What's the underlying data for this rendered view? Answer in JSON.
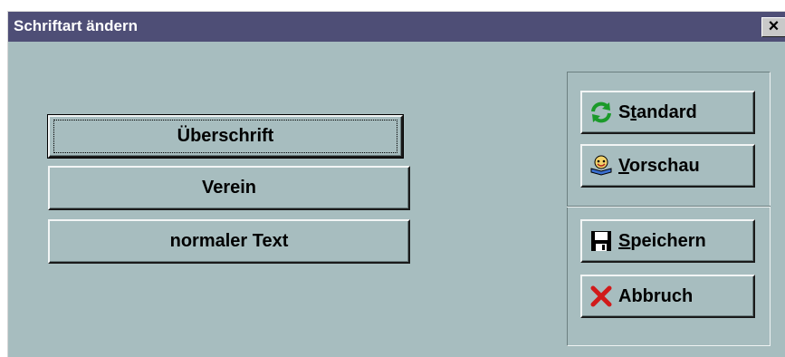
{
  "window": {
    "title": "Schriftart ändern",
    "close_label": "×"
  },
  "font_buttons": [
    {
      "label": "Überschrift",
      "focused": true
    },
    {
      "label": "Verein",
      "focused": false
    },
    {
      "label": "normaler Text",
      "focused": false
    }
  ],
  "side_buttons": {
    "standard": {
      "pre": "S",
      "accel": "t",
      "post": "andard",
      "icon": "refresh-icon"
    },
    "vorschau": {
      "pre": "",
      "accel": "V",
      "post": "orschau",
      "icon": "preview-icon"
    },
    "speichern": {
      "pre": "",
      "accel": "S",
      "post": "peichern",
      "icon": "save-icon"
    },
    "abbruch": {
      "pre": "Abbruch",
      "accel": "",
      "post": "",
      "icon": "cancel-icon"
    }
  },
  "colors": {
    "dialog_bg": "#a7bdbf",
    "titlebar_bg": "#4e4e76",
    "refresh_green": "#1b9a2a",
    "cancel_red": "#d11a1a"
  }
}
